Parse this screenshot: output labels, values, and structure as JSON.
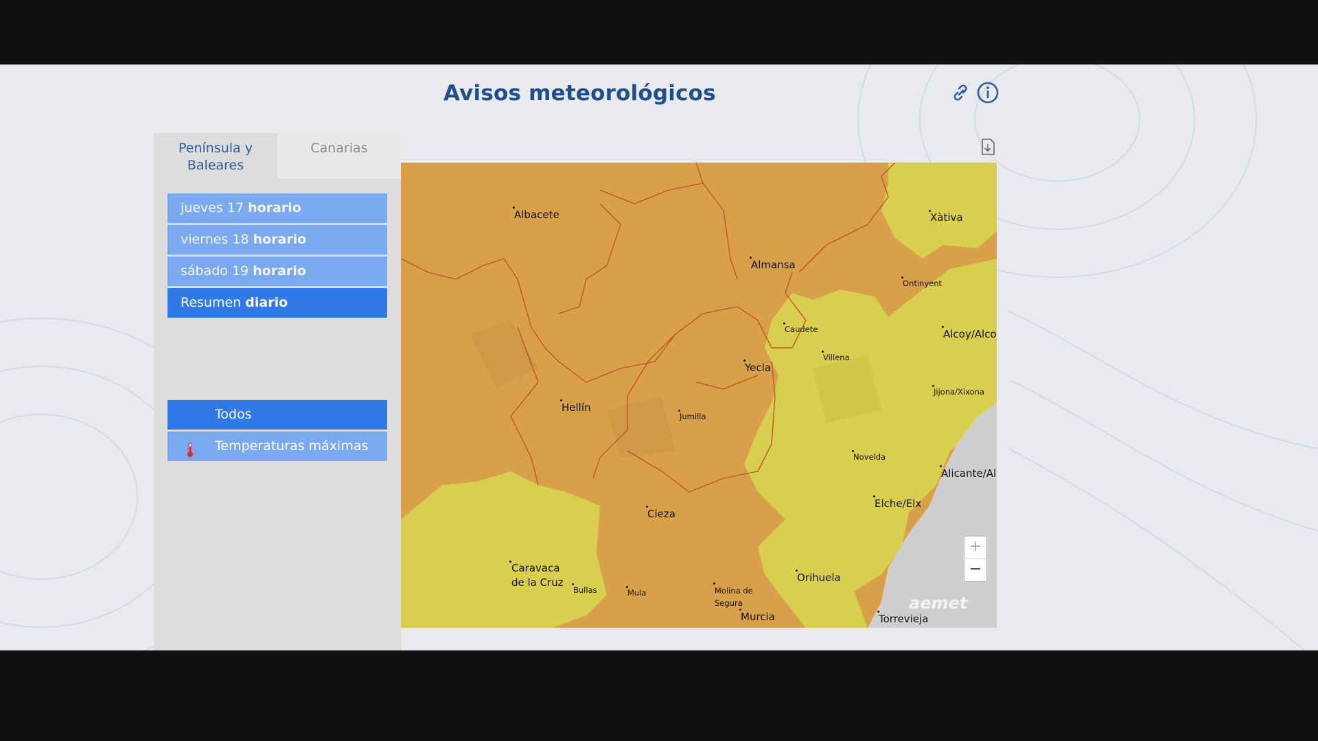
{
  "header": {
    "title": "Avisos meteorológicos"
  },
  "tabs": [
    {
      "label": "Península y Baleares",
      "active": true
    },
    {
      "label": "Canarias",
      "active": false
    }
  ],
  "days": [
    {
      "day": "jueves 17",
      "mode": "horario"
    },
    {
      "day": "viernes 18",
      "mode": "horario"
    },
    {
      "day": "sábado 19",
      "mode": "horario"
    },
    {
      "day": "Resumen",
      "mode": "diario",
      "selected": true
    }
  ],
  "filters": [
    {
      "label": "Todos",
      "selected": true
    },
    {
      "label": "Temperaturas máximas",
      "icon": "thermometer-icon"
    }
  ],
  "map": {
    "cities": [
      "Albacete",
      "Xàtiva",
      "Almansa",
      "Ontinyent",
      "Caudete",
      "Alcoy/Alco",
      "Yecla",
      "Villena",
      "Jijona/Xixona",
      "Hellín",
      "Jumilla",
      "Novelda",
      "Alicante/Ali",
      "Elche/Elx",
      "Cieza",
      "Caravaca de la Cruz",
      "Bullas",
      "Mula",
      "Molina de Segura",
      "Murcia",
      "Orihuela",
      "Torrevieja"
    ],
    "brand": "aemet",
    "zoom_in": "+",
    "zoom_out": "−",
    "colors": {
      "orange": "#d9a04a",
      "yellow": "#d9cf4e",
      "sea": "#cfcfcf",
      "border": "#c0562a"
    }
  },
  "icons": [
    "link-icon",
    "info-icon",
    "download-icon",
    "thermometer-icon"
  ]
}
